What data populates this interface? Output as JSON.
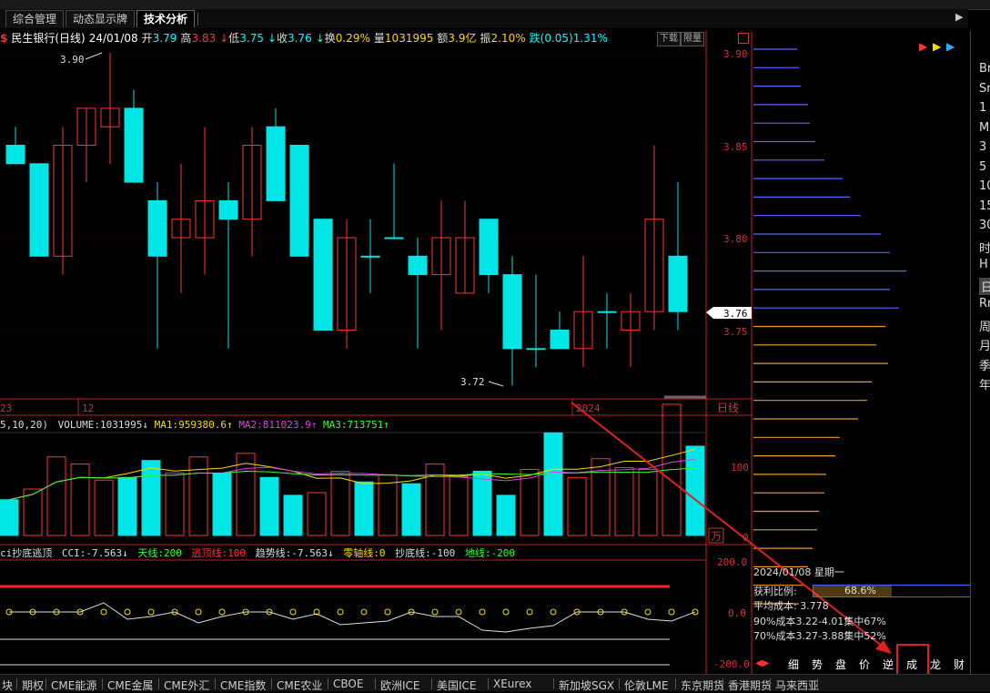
{
  "tabs": [
    {
      "label": "综合管理",
      "active": false
    },
    {
      "label": "动态显示牌",
      "active": false
    },
    {
      "label": "技术分析",
      "active": true
    }
  ],
  "stock_info": {
    "icon_char": "$",
    "name": "民生银行(日线)",
    "date": "24/01/08",
    "open_label": "开",
    "open": "3.79",
    "high_label": "高",
    "high": "3.83",
    "low_label": "低",
    "low": "3.75",
    "close_label": "收",
    "close": "3.76",
    "turnover_label": "换",
    "turnover": "0.29%",
    "volume_label": "量",
    "volume": "1031995",
    "amount_label": "额",
    "amount": "3.9亿",
    "amplitude_label": "振",
    "amplitude": "2.10%",
    "change_label": "跌",
    "change": "(0.05)",
    "change_pct": "1.31%"
  },
  "chart_buttons": [
    "下载",
    "限量"
  ],
  "price_chart": {
    "y_ticks": [
      "3.90",
      "3.85",
      "3.80",
      "3.75"
    ],
    "current_price": "3.76",
    "high_annotation": "3.90",
    "low_annotation": "3.72",
    "x_labels": [
      "23",
      "12",
      "2024"
    ],
    "period_label": "日线"
  },
  "volume_panel": {
    "params": "5,10,20)",
    "volume_label": "VOLUME:1031995",
    "ma1": "MA1:959380.6",
    "ma2": "MA2:811023.9",
    "ma3": "MA3:713751",
    "y_ticks": [
      "100",
      "0"
    ],
    "unit": "万"
  },
  "cci_panel": {
    "name": "ci抄底逃顶",
    "cci": "CCI:-7.563",
    "tian": "天线:200",
    "taoding": "逃顶线:100",
    "qushi": "趋势线:-7.563",
    "lingzhou": "零轴线:0",
    "chaodi": "抄底线:-100",
    "di": "地线:-200",
    "y_ticks": [
      "200.0",
      "0.0",
      "-200.0"
    ]
  },
  "cost_panel": {
    "date": "2024/01/08 星期一",
    "profit_label": "获利比例:",
    "profit_value": "68.6%",
    "avg_cost": "平均成本: 3.778",
    "cost90": "90%成本3.22-4.01集中67%",
    "cost70": "70%成本3.27-3.88集中52%",
    "tabs": [
      "细",
      "势",
      "盘",
      "价",
      "逆",
      "成",
      "龙",
      "财"
    ],
    "active_tab": "成"
  },
  "right_strip": [
    "Br",
    "Sr",
    "1",
    "M",
    "3",
    "5",
    "10",
    "15",
    "30",
    "时",
    "H",
    "日",
    "Rr",
    "周",
    "月",
    "季",
    "年"
  ],
  "bottom_bar": [
    "块",
    "期权",
    "CME能源",
    "CME金属",
    "CME外汇",
    "CME指数",
    "CME农业",
    "CBOE",
    "欧洲ICE",
    "美国ICE",
    "XEurex",
    "新加坡SGX",
    "伦敦LME",
    "东京期货",
    "香港期货",
    "马来西亚"
  ],
  "chart_data": {
    "type": "candlestick",
    "dates_first_label": "23",
    "candles": [
      {
        "o": 3.85,
        "h": 3.86,
        "l": 3.84,
        "c": 3.84
      },
      {
        "o": 3.84,
        "h": 3.84,
        "l": 3.79,
        "c": 3.79
      },
      {
        "o": 3.79,
        "h": 3.86,
        "l": 3.78,
        "c": 3.85
      },
      {
        "o": 3.85,
        "h": 3.87,
        "l": 3.83,
        "c": 3.87
      },
      {
        "o": 3.86,
        "h": 3.9,
        "l": 3.84,
        "c": 3.87
      },
      {
        "o": 3.87,
        "h": 3.88,
        "l": 3.83,
        "c": 3.83
      },
      {
        "o": 3.82,
        "h": 3.83,
        "l": 3.74,
        "c": 3.79
      },
      {
        "o": 3.8,
        "h": 3.84,
        "l": 3.77,
        "c": 3.81
      },
      {
        "o": 3.8,
        "h": 3.86,
        "l": 3.78,
        "c": 3.82
      },
      {
        "o": 3.82,
        "h": 3.83,
        "l": 3.74,
        "c": 3.81
      },
      {
        "o": 3.81,
        "h": 3.86,
        "l": 3.79,
        "c": 3.85
      },
      {
        "o": 3.86,
        "h": 3.87,
        "l": 3.82,
        "c": 3.82
      },
      {
        "o": 3.85,
        "h": 3.85,
        "l": 3.79,
        "c": 3.79
      },
      {
        "o": 3.81,
        "h": 3.81,
        "l": 3.75,
        "c": 3.75
      },
      {
        "o": 3.75,
        "h": 3.81,
        "l": 3.74,
        "c": 3.8
      },
      {
        "o": 3.79,
        "h": 3.81,
        "l": 3.77,
        "c": 3.79
      },
      {
        "o": 3.8,
        "h": 3.84,
        "l": 3.8,
        "c": 3.8
      },
      {
        "o": 3.79,
        "h": 3.8,
        "l": 3.74,
        "c": 3.78
      },
      {
        "o": 3.78,
        "h": 3.82,
        "l": 3.75,
        "c": 3.8
      },
      {
        "o": 3.77,
        "h": 3.82,
        "l": 3.77,
        "c": 3.8
      },
      {
        "o": 3.81,
        "h": 3.81,
        "l": 3.77,
        "c": 3.78
      },
      {
        "o": 3.78,
        "h": 3.79,
        "l": 3.72,
        "c": 3.74
      },
      {
        "o": 3.74,
        "h": 3.78,
        "l": 3.73,
        "c": 3.74
      },
      {
        "o": 3.75,
        "h": 3.76,
        "l": 3.74,
        "c": 3.74
      },
      {
        "o": 3.74,
        "h": 3.79,
        "l": 3.73,
        "c": 3.76
      },
      {
        "o": 3.76,
        "h": 3.77,
        "l": 3.74,
        "c": 3.76
      },
      {
        "o": 3.75,
        "h": 3.77,
        "l": 3.73,
        "c": 3.76
      },
      {
        "o": 3.76,
        "h": 3.85,
        "l": 3.75,
        "c": 3.81
      },
      {
        "o": 3.79,
        "h": 3.83,
        "l": 3.75,
        "c": 3.76
      }
    ],
    "volume": [
      40,
      52,
      88,
      80,
      62,
      65,
      84,
      70,
      88,
      70,
      92,
      65,
      45,
      48,
      72,
      60,
      68,
      58,
      80,
      66,
      72,
      45,
      74,
      115,
      65,
      86,
      76,
      74,
      147,
      100
    ],
    "ylim": [
      3.7,
      3.91
    ],
    "volume_ylim": [
      0,
      150
    ]
  }
}
